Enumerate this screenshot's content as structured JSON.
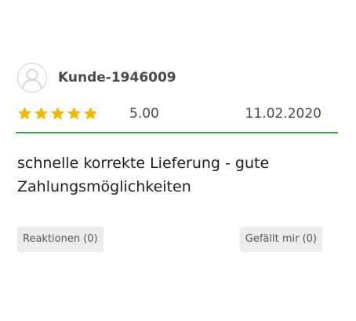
{
  "review": {
    "username": "Kunde-1946009",
    "avatar_icon": "user-placeholder-icon",
    "rating": {
      "stars_filled": 5,
      "stars_total": 5,
      "star_color": "#f5b800",
      "value_label": "5.00"
    },
    "date": "11.02.2020",
    "divider_color": "#3aa54a",
    "text": "schnelle korrekte Lieferung - gute Zahlungsmöglichkeiten",
    "actions": {
      "reactions_label": "Reaktionen (0)",
      "like_label": "Gefällt mir (0)"
    }
  }
}
